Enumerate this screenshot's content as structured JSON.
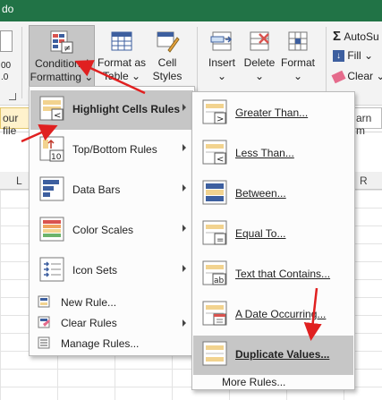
{
  "window": {
    "title": "do"
  },
  "ribbon": {
    "conditional_formatting": {
      "line1": "Conditional",
      "line2": "Formatting ⌄"
    },
    "format_as_table": {
      "line1": "Format as",
      "line2": "Table ⌄"
    },
    "cell_styles": {
      "line1": "Cell",
      "line2": "Styles ⌄"
    },
    "insert": {
      "label": "Insert",
      "sub": "⌄"
    },
    "delete": {
      "label": "Delete",
      "sub": "⌄"
    },
    "format": {
      "label": "Format",
      "sub": "⌄"
    },
    "autosum": "AutoSu",
    "fill": "Fill ⌄",
    "clear": "Clear ⌄",
    "left_num1": "00",
    "left_num2": ".0"
  },
  "infobar": {
    "left_text": "our file",
    "right_text": "arn m"
  },
  "columns": {
    "left": "L",
    "right": "R"
  },
  "menu_main": {
    "items": [
      {
        "label": "Highlight Cells Rules",
        "underline": "H",
        "highlighted": true,
        "has_submenu": true
      },
      {
        "label": "Top/Bottom Rules",
        "has_submenu": true
      },
      {
        "label": "Data Bars",
        "has_submenu": true
      },
      {
        "label": "Color Scales",
        "has_submenu": true
      },
      {
        "label": "Icon Sets",
        "has_submenu": true
      },
      {
        "label": "New Rule..."
      },
      {
        "label": "Clear Rules",
        "has_submenu": true
      },
      {
        "label": "Manage Rules..."
      }
    ],
    "topbottom_badge": "10"
  },
  "menu_sub": {
    "items": [
      {
        "label": "Greater Than..."
      },
      {
        "label": "Less Than..."
      },
      {
        "label": "Between..."
      },
      {
        "label": "Equal To..."
      },
      {
        "label": "Text that Contains..."
      },
      {
        "label": "A Date Occurring..."
      },
      {
        "label": "Duplicate Values...",
        "highlighted": true
      },
      {
        "label": "More Rules..."
      }
    ],
    "icon_symbols": [
      ">",
      "<",
      "",
      "=",
      "ab",
      "",
      "",
      ""
    ]
  },
  "colors": {
    "excel_green": "#217346",
    "menu_highlight": "#c6c6c6",
    "annotation_red": "#e02020",
    "rule_yellow": "#f2d38f",
    "rule_blue": "#3d5f9f"
  }
}
